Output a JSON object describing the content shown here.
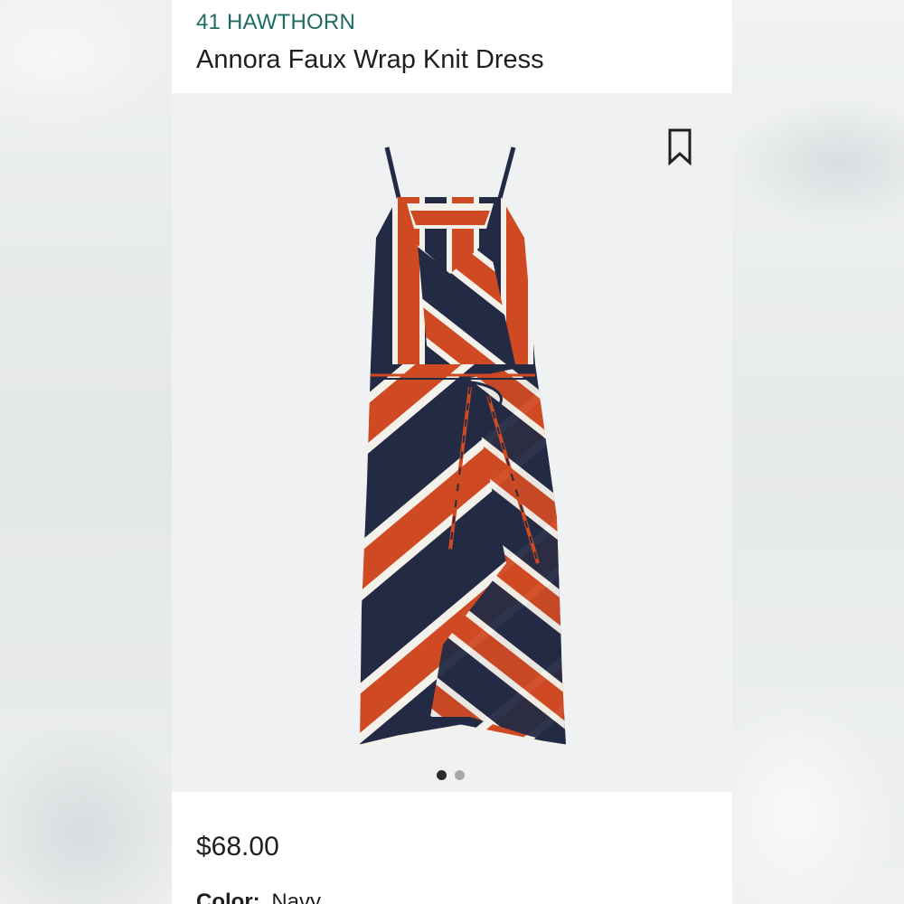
{
  "product": {
    "brand": "41 HAWTHORN",
    "title": "Annora Faux Wrap Knit Dress",
    "price": "$68.00",
    "color_label": "Color:",
    "color_value": "Navy"
  },
  "carousel": {
    "total_images": 2,
    "active_index": 0
  },
  "icons": {
    "bookmark": "bookmark-icon"
  },
  "colors": {
    "brand_green": "#1d6b63",
    "stripe_navy": "#232a44",
    "stripe_orange": "#cf4a22",
    "stripe_white": "#f4f1ea"
  }
}
